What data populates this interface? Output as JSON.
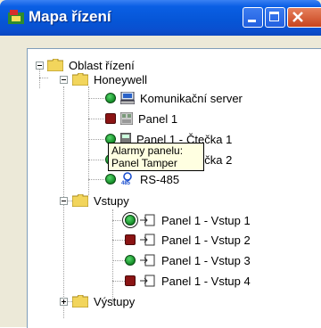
{
  "window": {
    "title": "Mapa řízení",
    "icon": "app-map-icon",
    "buttons": {
      "minimize": "minimize-button",
      "maximize": "maximize-button",
      "close": "close-button"
    }
  },
  "tree": {
    "root": "Oblast řízení",
    "honeywell": "Honeywell",
    "comm_server": "Komunikační server",
    "panel1": "Panel 1",
    "reader1": "Panel 1 - Čtečka 1",
    "reader1_suffix": "Čtečka 1",
    "reader2_suffix": "Čtečka 2",
    "reader1_prefix": "Panel 1 -",
    "rs485": "RS-485",
    "rs485_badge": "485",
    "inputs": "Vstupy",
    "input1": "Panel 1 - Vstup 1",
    "input2": "Panel 1 - Vstup 2",
    "input3": "Panel 1 - Vstup 3",
    "input4": "Panel 1 - Vstup 4",
    "outputs": "Výstupy"
  },
  "tooltip": {
    "line1": "Alarmy panelu:",
    "line2": "Panel Tamper"
  },
  "colors": {
    "titlebar": "#0a5fe4",
    "ok": "#138a26",
    "alarm": "#8b1414",
    "folder": "#f2d55c"
  }
}
